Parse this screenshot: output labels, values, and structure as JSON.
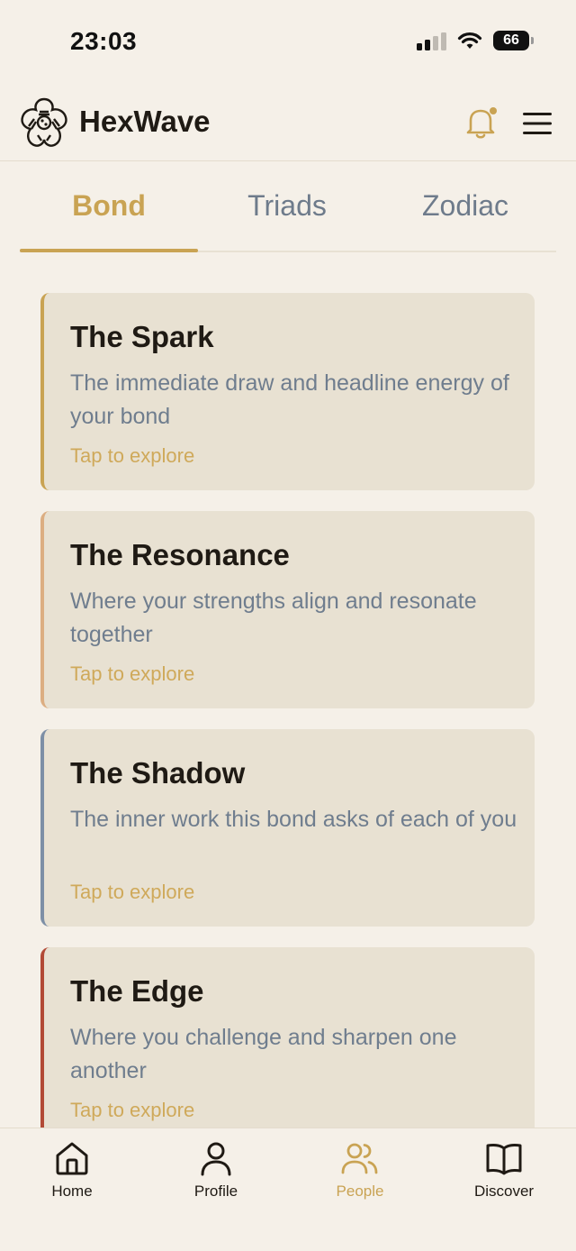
{
  "status_bar": {
    "time": "23:03",
    "battery": "66"
  },
  "header": {
    "app_title": "HexWave",
    "logo_icon": "hexwave-logo-icon",
    "notification_icon": "bell-icon",
    "menu_icon": "hamburger-menu-icon"
  },
  "tabs": [
    {
      "label": "Bond",
      "active": true
    },
    {
      "label": "Triads",
      "active": false
    },
    {
      "label": "Zodiac",
      "active": false
    }
  ],
  "cards": [
    {
      "title": "The Spark",
      "description": "The immediate draw and headline energy of your bond",
      "cta": "Tap to explore",
      "accent": "#c9a353"
    },
    {
      "title": "The Resonance",
      "description": "Where your strengths align and resonate together",
      "cta": "Tap to explore",
      "accent": "#dcae82"
    },
    {
      "title": "The Shadow",
      "description": "The inner work this bond asks of each of you",
      "cta": "Tap to explore",
      "accent": "#7d8fa6"
    },
    {
      "title": "The Edge",
      "description": "Where you challenge and sharpen one another",
      "cta": "Tap to explore",
      "accent": "#b24a36"
    }
  ],
  "bottom_nav": [
    {
      "label": "Home",
      "icon": "home-icon",
      "active": false
    },
    {
      "label": "Profile",
      "icon": "user-icon",
      "active": false
    },
    {
      "label": "People",
      "icon": "people-icon",
      "active": true
    },
    {
      "label": "Discover",
      "icon": "book-icon",
      "active": false
    }
  ],
  "colors": {
    "accent_gold": "#c9a353",
    "background": "#f5f0e8",
    "card_background": "#e8e1d2",
    "muted_text": "#6f7d8e"
  }
}
